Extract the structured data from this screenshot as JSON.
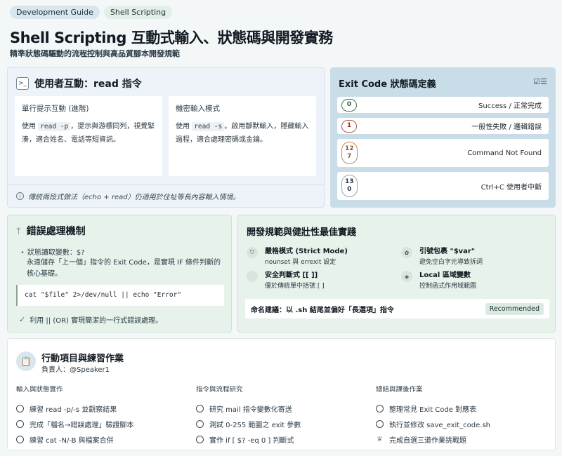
{
  "tags": [
    "Development Guide",
    "Shell Scripting"
  ],
  "page": {
    "title": "Shell Scripting 互動式輸入、狀態碼與開發實務",
    "subtitle": "精準狀態碼驅動的流程控制與高品質腳本開發規範"
  },
  "read_card": {
    "title": "使用者互動：read 指令",
    "box1": {
      "heading": "單行提示互動 (進階)",
      "pre": "使用 ",
      "code": "read -p",
      "post": "，提示與游標同列，視覺緊湊，適合姓名、電話等短資訊。"
    },
    "box2": {
      "heading": "機密輸入模式",
      "pre": "使用 ",
      "code": "read -s",
      "post": "。啟用靜默輸入，隱藏輸入過程，適合處理密碼或金鑰。"
    },
    "footer": "傳統兩段式做法（echo + read）仍適用於住址等長內容輸入情境。"
  },
  "exit_card": {
    "title": "Exit Code 狀態碼定義",
    "rows": [
      {
        "code": "0",
        "desc": "Success / 正常完成"
      },
      {
        "code": "1",
        "desc": "一般性失敗 / 邏輯錯誤"
      },
      {
        "code_lines": [
          "12",
          "7"
        ],
        "desc": "Command Not Found"
      },
      {
        "code_lines": [
          "13",
          "0"
        ],
        "desc": "Ctrl+C 使用者中斷"
      }
    ]
  },
  "error_card": {
    "title": "錯誤處理機制",
    "bullet": "狀態讀取變數：$?",
    "desc": "永遠儲存「上一個」指令的 Exit Code，是實現 IF 條件判斷的核心基礎。",
    "code": "cat \"$file\" 2>/dev/null || echo \"Error\"",
    "check": "利用 || (OR) 實現簡潔的一行式錯誤處理。"
  },
  "best_practice": {
    "title": "開發規範與健壯性最佳實踐",
    "items": [
      {
        "title": "嚴格模式 (Strict Mode)",
        "desc": "nounset 與 errexit 設定"
      },
      {
        "title": "引號包裹 \"$var\"",
        "desc": "避免空白字元導致拆詞"
      },
      {
        "title": "安全判斷式 [[ ]]",
        "desc": "優於傳統單中括號 [ ]"
      },
      {
        "title": "Local 區域變數",
        "desc": "控制函式作用域範圍"
      }
    ],
    "footer": "命名建議：以 .sh 結尾並偏好「長選項」指令",
    "badge": "Recommended"
  },
  "action_card": {
    "title": "行動項目與練習作業",
    "owner": "負責人：@Speaker1",
    "columns": [
      {
        "heading": "輸入與狀態實作",
        "tasks": [
          "練習 read -p/-s 並觀察結果",
          "完成「檔名→錯誤處理」驗證腳本",
          "練習 cat -N/-B 與檔案合併"
        ]
      },
      {
        "heading": "指令與流程研究",
        "tasks": [
          "研究 mail 指令變數化寄送",
          "測試 0-255 範圍之 exit 參數",
          "實作 if [ $? -eq 0 ] 判斷式"
        ]
      },
      {
        "heading": "總結與課後作業",
        "tasks": [
          "整理常見 Exit Code 對應表",
          "執行並修改 save_exit_code.sh",
          "完成自選三道作業挑戰題"
        ]
      }
    ]
  }
}
